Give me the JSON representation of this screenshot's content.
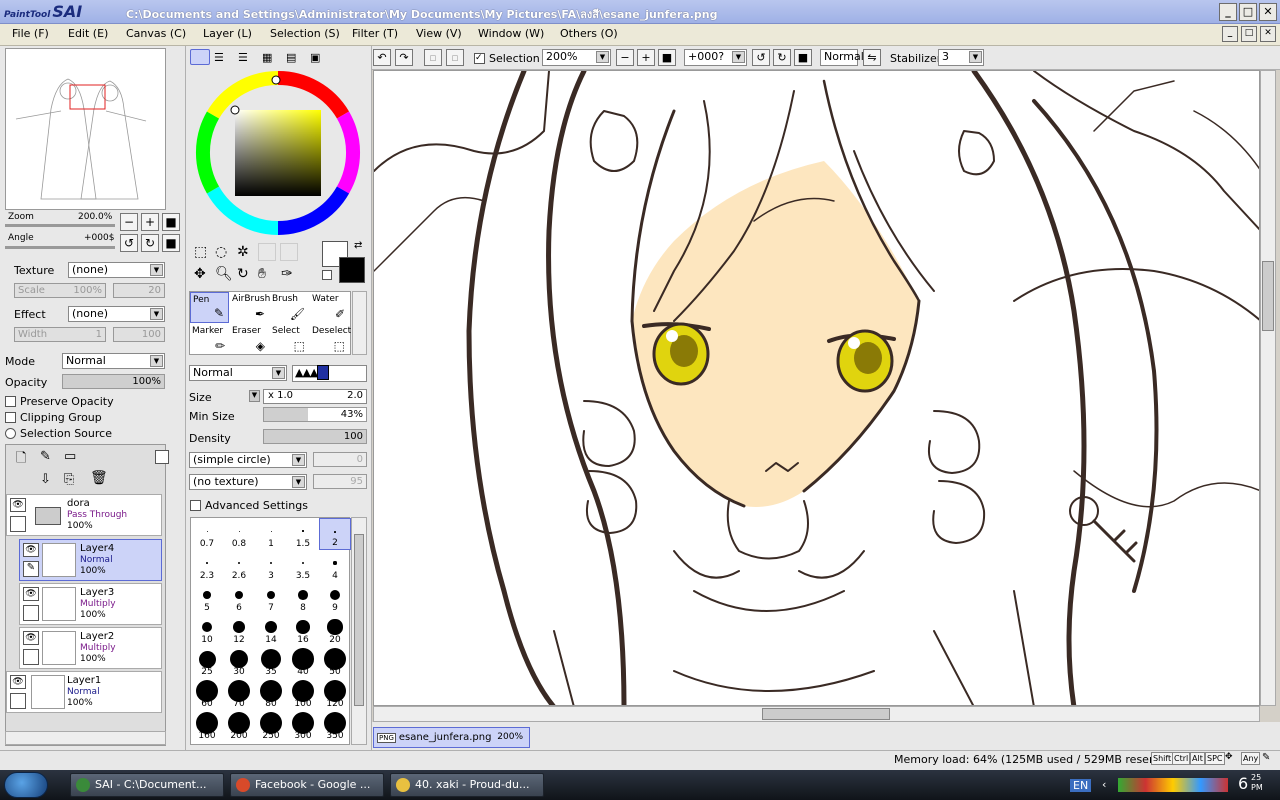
{
  "app": {
    "logo_small": "PaintTool",
    "logo_big": "SAI",
    "title_path": "C:\\Documents and Settings\\Administrator\\My Documents\\My Pictures\\FA\\ลงสี\\esane_junfera.png"
  },
  "menu": [
    "File (F)",
    "Edit (E)",
    "Canvas (C)",
    "Layer (L)",
    "Selection (S)",
    "Filter (T)",
    "View (V)",
    "Window (W)",
    "Others (O)"
  ],
  "navigator": {
    "zoom_label": "Zoom",
    "zoom_value": "200.0%",
    "angle_label": "Angle",
    "angle_value": "+000$"
  },
  "texture": {
    "label": "Texture",
    "value": "(none)",
    "scale_label": "Scale",
    "scale_value": "100%",
    "scale_num": "20"
  },
  "effect": {
    "label": "Effect",
    "value": "(none)",
    "width_label": "Width",
    "width_value": "1",
    "width_num": "100"
  },
  "layer_props": {
    "mode_label": "Mode",
    "mode_value": "Normal",
    "opacity_label": "Opacity",
    "opacity_value": "100%",
    "preserve": "Preserve Opacity",
    "clipping": "Clipping Group",
    "selection_source": "Selection Source"
  },
  "layers": [
    {
      "name": "dora",
      "mode": "Pass Through",
      "opacity": "100%",
      "mode_color": "#7a1a8a"
    },
    {
      "name": "Layer4",
      "mode": "Normal",
      "opacity": "100%",
      "mode_color": "#1a1a8a"
    },
    {
      "name": "Layer3",
      "mode": "Multiply",
      "opacity": "100%",
      "mode_color": "#7a1a8a"
    },
    {
      "name": "Layer2",
      "mode": "Multiply",
      "opacity": "100%",
      "mode_color": "#7a1a8a"
    },
    {
      "name": "Layer1",
      "mode": "Normal",
      "opacity": "100%",
      "mode_color": "#1a1a8a"
    }
  ],
  "tools": [
    "Pen",
    "AirBrush",
    "Brush",
    "Water",
    "Marker",
    "Eraser",
    "Select",
    "Deselect"
  ],
  "brush": {
    "blend": "Normal",
    "size_label": "Size",
    "size_mult": "x 1.0",
    "size_value": "2.0",
    "minsize_label": "Min Size",
    "minsize_value": "43%",
    "density_label": "Density",
    "density_value": "100",
    "shape": "(simple circle)",
    "shape_num": "0",
    "texture": "(no texture)",
    "texture_num": "95",
    "advanced": "Advanced Settings"
  },
  "brush_sizes": [
    "0.7",
    "0.8",
    "1",
    "1.5",
    "2",
    "2.3",
    "2.6",
    "3",
    "3.5",
    "4",
    "5",
    "6",
    "7",
    "8",
    "9",
    "10",
    "12",
    "14",
    "16",
    "20",
    "25",
    "30",
    "35",
    "40",
    "50",
    "60",
    "70",
    "80",
    "100",
    "120",
    "160",
    "200",
    "250",
    "300",
    "350"
  ],
  "canvas_toolbar": {
    "selection_label": "Selection",
    "zoom": "200%",
    "rotate": "+000?",
    "blend": "Normal",
    "stabilizer_label": "Stabilizer",
    "stabilizer_value": "3"
  },
  "doc_tab": {
    "name": "esane_junfera.png",
    "zoom": "200%",
    "badge": "PNG"
  },
  "status": {
    "memory": "Memory load: 64% (125MB used / 529MB reserved)",
    "keys": [
      "Shift",
      "Ctrl",
      "Alt",
      "SPC",
      "Any"
    ]
  },
  "taskbar": {
    "items": [
      {
        "label": "SAI - C:\\Document...",
        "color": "#3a8a3a"
      },
      {
        "label": "Facebook - Google ...",
        "color": "#d84a2a"
      },
      {
        "label": "40. xaki - Proud-du...",
        "color": "#e8c040"
      }
    ],
    "lang": "EN",
    "time": "6",
    "time_suffix": "PM",
    "date": "25"
  },
  "colors": {
    "skin": "#fde6bf",
    "eye": "#e0d40e",
    "line": "#3a2a24",
    "select": "#ccd3f8"
  }
}
